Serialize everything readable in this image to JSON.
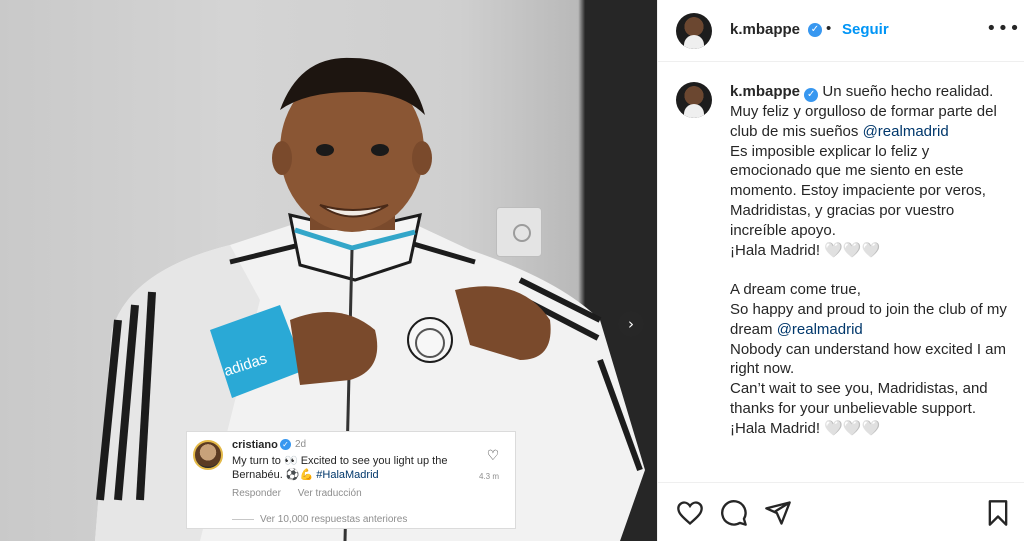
{
  "header": {
    "username": "k.mbappe",
    "verified_icon": "verified-badge-icon",
    "follow_label": "Seguir",
    "more_icon": "more-options-icon"
  },
  "caption": {
    "username": "k.mbappe",
    "lines": [
      "Un sueño hecho realidad.",
      "Muy feliz y orgulloso de formar parte del club de mis sueños ",
      "@realmadrid",
      "Es imposible explicar lo feliz y emocionado que me siento en este momento. Estoy impaciente por veros, Madridistas, y gracias por vuestro increíble apoyo.",
      "¡Hala Madrid! 🤍🤍🤍",
      "A dream come true,",
      "So happy and proud to join the club of my dream ",
      "@realmadrid",
      "Nobody can understand how excited I am right now.",
      "Can’t wait to see you, Madridistas, and thanks for your unbelievable support.",
      "¡Hala Madrid! 🤍🤍🤍"
    ]
  },
  "comment": {
    "username": "cristiano",
    "time": "2d",
    "text_before": "My turn to 👀 Excited to see you light up the Bernabéu. ⚽💪 ",
    "hashtag": "#HalaMadrid",
    "likes": "4.3 m",
    "reply_label": "Responder",
    "translate_label": "Ver traducción",
    "more_replies_label": "Ver 10,000 respuestas anteriores"
  },
  "photo": {
    "jacket_logo_text": "adidas"
  },
  "icons": {
    "like": "heart-icon",
    "comment": "comment-icon",
    "share": "share-icon",
    "save": "bookmark-icon",
    "next": "next-arrow-icon"
  },
  "colors": {
    "link_blue": "#0095f6",
    "verified_blue": "#3797f0",
    "mention_blue": "#00376b"
  }
}
